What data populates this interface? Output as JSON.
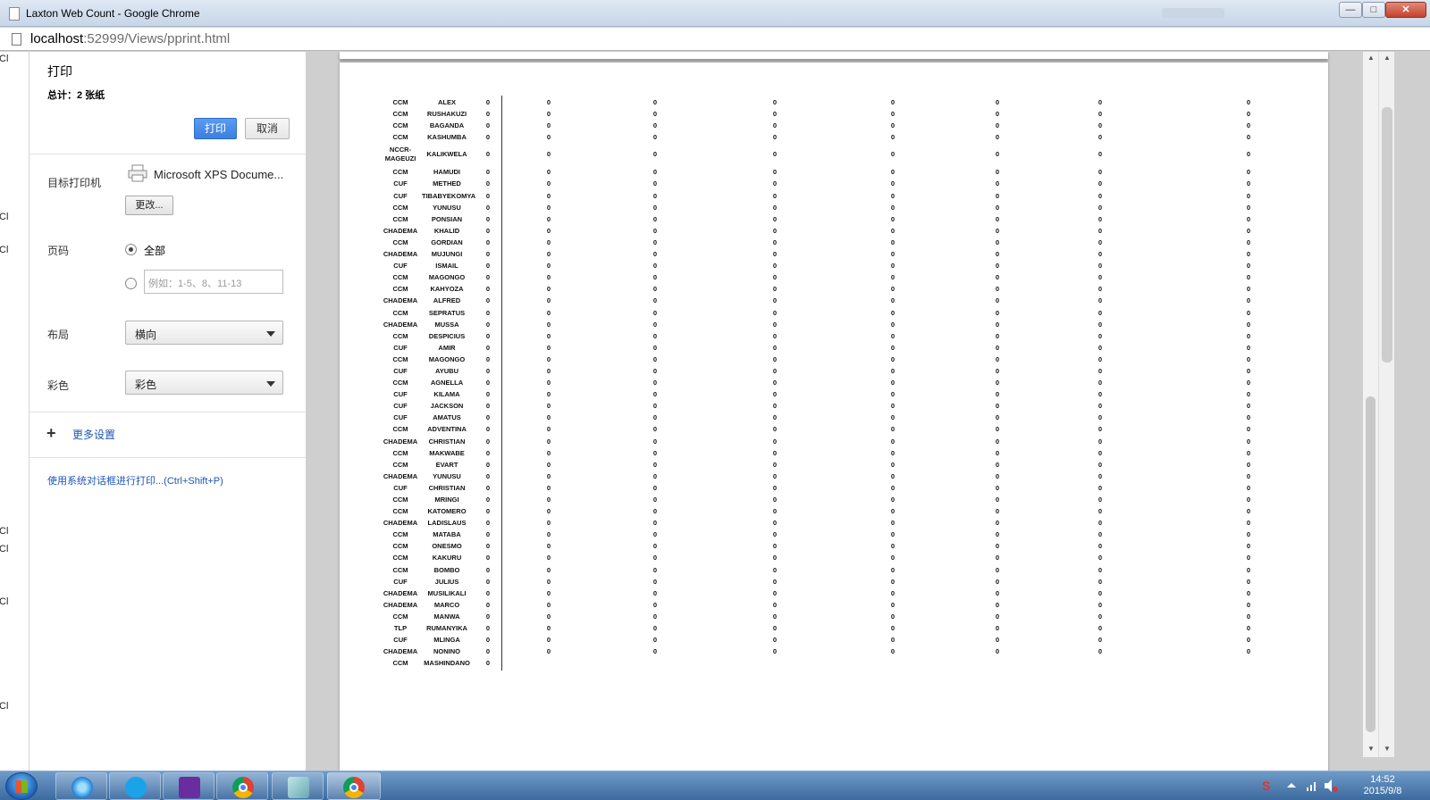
{
  "window": {
    "title": "Laxton Web Count - Google Chrome",
    "buttons": {
      "minimize": "—",
      "maximize": "□",
      "close": "✕"
    }
  },
  "address": {
    "host": "localhost",
    "rest": ":52999/Views/pprint.html"
  },
  "background_page": {
    "letters": [
      "Cl",
      "Cl",
      "Cl",
      "Cl",
      "Cl",
      "Cl",
      "Cl",
      "Cl"
    ]
  },
  "print": {
    "title": "打印",
    "total": "总计：2 张纸",
    "print_button": "打印",
    "cancel_button": "取消",
    "destination_label": "目标打印机",
    "printer_name": "Microsoft XPS Docume...",
    "change_button": "更改...",
    "pages_label": "页码",
    "pages_all": "全部",
    "pages_placeholder": "例如：1-5、8、11-13",
    "layout_label": "布局",
    "layout_value": "横向",
    "color_label": "彩色",
    "color_value": "彩色",
    "more_settings": "更多设置",
    "system_dialog": "使用系统对话框进行打印...(Ctrl+Shift+P)"
  },
  "preview_table": {
    "rows": [
      {
        "party": "CCM",
        "name": "ALEX",
        "votes": [
          "0",
          "0",
          "0",
          "0",
          "0",
          "0",
          "0",
          "0"
        ]
      },
      {
        "party": "CCM",
        "name": "RUSHAKUZI",
        "votes": [
          "0",
          "0",
          "0",
          "0",
          "0",
          "0",
          "0",
          "0"
        ]
      },
      {
        "party": "CCM",
        "name": "BAGANDA",
        "votes": [
          "0",
          "0",
          "0",
          "0",
          "0",
          "0",
          "0",
          "0"
        ]
      },
      {
        "party": "CCM",
        "name": "KASHUMBA",
        "votes": [
          "0",
          "0",
          "0",
          "0",
          "0",
          "0",
          "0",
          "0"
        ]
      },
      {
        "party": "NCCR-MAGEUZI",
        "name": "KALIKWELA",
        "votes": [
          "0",
          "0",
          "0",
          "0",
          "0",
          "0",
          "0",
          "0"
        ]
      },
      {
        "party": "CCM",
        "name": "HAMUDI",
        "votes": [
          "0",
          "0",
          "0",
          "0",
          "0",
          "0",
          "0",
          "0"
        ]
      },
      {
        "party": "CUF",
        "name": "METHED",
        "votes": [
          "0",
          "0",
          "0",
          "0",
          "0",
          "0",
          "0",
          "0"
        ]
      },
      {
        "party": "CUF",
        "name": "TIBABYEKOMYA",
        "votes": [
          "0",
          "0",
          "0",
          "0",
          "0",
          "0",
          "0",
          "0"
        ]
      },
      {
        "party": "CCM",
        "name": "YUNUSU",
        "votes": [
          "0",
          "0",
          "0",
          "0",
          "0",
          "0",
          "0",
          "0"
        ]
      },
      {
        "party": "CCM",
        "name": "PONSIAN",
        "votes": [
          "0",
          "0",
          "0",
          "0",
          "0",
          "0",
          "0",
          "0"
        ]
      },
      {
        "party": "CHADEMA",
        "name": "KHALID",
        "votes": [
          "0",
          "0",
          "0",
          "0",
          "0",
          "0",
          "0",
          "0"
        ]
      },
      {
        "party": "CCM",
        "name": "GORDIAN",
        "votes": [
          "0",
          "0",
          "0",
          "0",
          "0",
          "0",
          "0",
          "0"
        ]
      },
      {
        "party": "CHADEMA",
        "name": "MUJUNGI",
        "votes": [
          "0",
          "0",
          "0",
          "0",
          "0",
          "0",
          "0",
          "0"
        ]
      },
      {
        "party": "CUF",
        "name": "ISMAIL",
        "votes": [
          "0",
          "0",
          "0",
          "0",
          "0",
          "0",
          "0",
          "0"
        ]
      },
      {
        "party": "CCM",
        "name": "MAGONGO",
        "votes": [
          "0",
          "0",
          "0",
          "0",
          "0",
          "0",
          "0",
          "0"
        ]
      },
      {
        "party": "CCM",
        "name": "KAHYOZA",
        "votes": [
          "0",
          "0",
          "0",
          "0",
          "0",
          "0",
          "0",
          "0"
        ]
      },
      {
        "party": "CHADEMA",
        "name": "ALFRED",
        "votes": [
          "0",
          "0",
          "0",
          "0",
          "0",
          "0",
          "0",
          "0"
        ]
      },
      {
        "party": "CCM",
        "name": "SEPRATUS",
        "votes": [
          "0",
          "0",
          "0",
          "0",
          "0",
          "0",
          "0",
          "0"
        ]
      },
      {
        "party": "CHADEMA",
        "name": "MUSSA",
        "votes": [
          "0",
          "0",
          "0",
          "0",
          "0",
          "0",
          "0",
          "0"
        ]
      },
      {
        "party": "CCM",
        "name": "DESPICIUS",
        "votes": [
          "0",
          "0",
          "0",
          "0",
          "0",
          "0",
          "0",
          "0"
        ]
      },
      {
        "party": "CUF",
        "name": "AMIR",
        "votes": [
          "0",
          "0",
          "0",
          "0",
          "0",
          "0",
          "0",
          "0"
        ]
      },
      {
        "party": "CCM",
        "name": "MAGONGO",
        "votes": [
          "0",
          "0",
          "0",
          "0",
          "0",
          "0",
          "0",
          "0"
        ]
      },
      {
        "party": "CUF",
        "name": "AYUBU",
        "votes": [
          "0",
          "0",
          "0",
          "0",
          "0",
          "0",
          "0",
          "0"
        ]
      },
      {
        "party": "CCM",
        "name": "AGNELLA",
        "votes": [
          "0",
          "0",
          "0",
          "0",
          "0",
          "0",
          "0",
          "0"
        ]
      },
      {
        "party": "CUF",
        "name": "KILAMA",
        "votes": [
          "0",
          "0",
          "0",
          "0",
          "0",
          "0",
          "0",
          "0"
        ]
      },
      {
        "party": "CUF",
        "name": "JACKSON",
        "votes": [
          "0",
          "0",
          "0",
          "0",
          "0",
          "0",
          "0",
          "0"
        ]
      },
      {
        "party": "CUF",
        "name": "AMATUS",
        "votes": [
          "0",
          "0",
          "0",
          "0",
          "0",
          "0",
          "0",
          "0"
        ]
      },
      {
        "party": "CCM",
        "name": "ADVENTINA",
        "votes": [
          "0",
          "0",
          "0",
          "0",
          "0",
          "0",
          "0",
          "0"
        ]
      },
      {
        "party": "CHADEMA",
        "name": "CHRISTIAN",
        "votes": [
          "0",
          "0",
          "0",
          "0",
          "0",
          "0",
          "0",
          "0"
        ]
      },
      {
        "party": "CCM",
        "name": "MAKWABE",
        "votes": [
          "0",
          "0",
          "0",
          "0",
          "0",
          "0",
          "0",
          "0"
        ]
      },
      {
        "party": "CCM",
        "name": "EVART",
        "votes": [
          "0",
          "0",
          "0",
          "0",
          "0",
          "0",
          "0",
          "0"
        ]
      },
      {
        "party": "CHADEMA",
        "name": "YUNUSU",
        "votes": [
          "0",
          "0",
          "0",
          "0",
          "0",
          "0",
          "0",
          "0"
        ]
      },
      {
        "party": "CUF",
        "name": "CHRISTIAN",
        "votes": [
          "0",
          "0",
          "0",
          "0",
          "0",
          "0",
          "0",
          "0"
        ]
      },
      {
        "party": "CCM",
        "name": "MRINGI",
        "votes": [
          "0",
          "0",
          "0",
          "0",
          "0",
          "0",
          "0",
          "0"
        ]
      },
      {
        "party": "CCM",
        "name": "KATOMERO",
        "votes": [
          "0",
          "0",
          "0",
          "0",
          "0",
          "0",
          "0",
          "0"
        ]
      },
      {
        "party": "CHADEMA",
        "name": "LADISLAUS",
        "votes": [
          "0",
          "0",
          "0",
          "0",
          "0",
          "0",
          "0",
          "0"
        ]
      },
      {
        "party": "CCM",
        "name": "MATABA",
        "votes": [
          "0",
          "0",
          "0",
          "0",
          "0",
          "0",
          "0",
          "0"
        ]
      },
      {
        "party": "CCM",
        "name": "ONESMO",
        "votes": [
          "0",
          "0",
          "0",
          "0",
          "0",
          "0",
          "0",
          "0"
        ]
      },
      {
        "party": "CCM",
        "name": "KAKURU",
        "votes": [
          "0",
          "0",
          "0",
          "0",
          "0",
          "0",
          "0",
          "0"
        ]
      },
      {
        "party": "CCM",
        "name": "BOMBO",
        "votes": [
          "0",
          "0",
          "0",
          "0",
          "0",
          "0",
          "0",
          "0"
        ]
      },
      {
        "party": "CUF",
        "name": "JULIUS",
        "votes": [
          "0",
          "0",
          "0",
          "0",
          "0",
          "0",
          "0",
          "0"
        ]
      },
      {
        "party": "CHADEMA",
        "name": "MUSILIKALI",
        "votes": [
          "0",
          "0",
          "0",
          "0",
          "0",
          "0",
          "0",
          "0"
        ]
      },
      {
        "party": "CHADEMA",
        "name": "MARCO",
        "votes": [
          "0",
          "0",
          "0",
          "0",
          "0",
          "0",
          "0",
          "0"
        ]
      },
      {
        "party": "CCM",
        "name": "MANWA",
        "votes": [
          "0",
          "0",
          "0",
          "0",
          "0",
          "0",
          "0",
          "0"
        ]
      },
      {
        "party": "TLP",
        "name": "RUMANYIKA",
        "votes": [
          "0",
          "0",
          "0",
          "0",
          "0",
          "0",
          "0",
          "0"
        ]
      },
      {
        "party": "CUF",
        "name": "MLINGA",
        "votes": [
          "0",
          "0",
          "0",
          "0",
          "0",
          "0",
          "0",
          "0"
        ]
      },
      {
        "party": "CHADEMA",
        "name": "NONINO",
        "votes": [
          "0",
          "0",
          "0",
          "0",
          "0",
          "0",
          "0",
          "0"
        ]
      },
      {
        "party": "CCM",
        "name": "MASHINDANO",
        "votes": [
          "0"
        ]
      }
    ]
  },
  "taskbar": {
    "items": [
      "ie-icon",
      "skype-icon",
      "visual-studio-icon",
      "chrome-icon",
      "app-icon",
      "chrome-icon"
    ],
    "time": "14:52",
    "date": "2015/9/8"
  }
}
